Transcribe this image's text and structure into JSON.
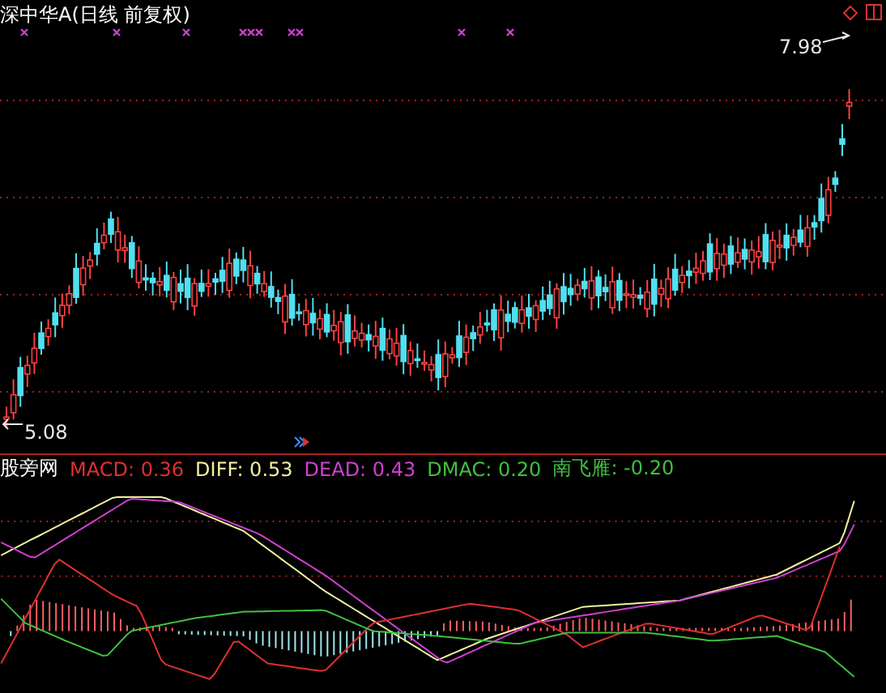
{
  "title": "深中华A(日线 前复权)",
  "price_chart": {
    "high_label": "7.98",
    "low_label": "5.08"
  },
  "indicator": {
    "name": "股旁网",
    "items": [
      {
        "label": "MACD: 0.36",
        "color": "#e03030"
      },
      {
        "label": "DIFF: 0.53",
        "color": "#f0f0a0"
      },
      {
        "label": "DEAD: 0.43",
        "color": "#d040d0"
      },
      {
        "label": "DMAC: 0.20",
        "color": "#40c040"
      },
      {
        "label": "南飞雁: -0.20",
        "color": "#40c040"
      }
    ]
  }
}
